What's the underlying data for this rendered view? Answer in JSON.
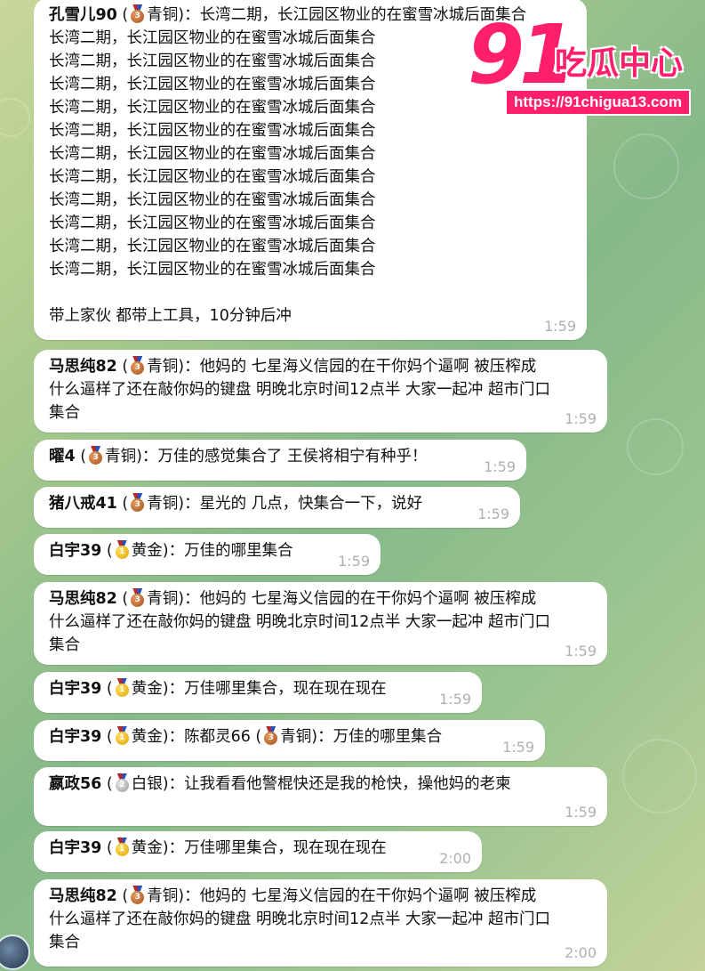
{
  "messages": [
    {
      "name": "孔雪儿90",
      "medal": "bronze",
      "rank": "青铜",
      "lines": [
        "长湾二期，长江园区物业的在蜜雪冰城后面集合",
        "长湾二期，长江园区物业的在蜜雪冰城后面集合",
        "长湾二期，长江园区物业的在蜜雪冰城后面集合",
        "长湾二期，长江园区物业的在蜜雪冰城后面集合",
        "长湾二期，长江园区物业的在蜜雪冰城后面集合",
        "长湾二期，长江园区物业的在蜜雪冰城后面集合",
        "长湾二期，长江园区物业的在蜜雪冰城后面集合",
        "长湾二期，长江园区物业的在蜜雪冰城后面集合",
        "长湾二期，长江园区物业的在蜜雪冰城后面集合",
        "长湾二期，长江园区物业的在蜜雪冰城后面集合",
        "长湾二期，长江园区物业的在蜜雪冰城后面集合",
        "长湾二期，长江园区物业的在蜜雪冰城后面集合",
        "",
        "带上家伙 都带上工具，10分钟后冲"
      ],
      "time": "1:59"
    },
    {
      "name": "马思纯82",
      "medal": "bronze",
      "rank": "青铜",
      "lines": [
        "他妈的 七星海义信园的在干你妈个逼啊 被压榨成",
        "什么逼样了还在敲你妈的键盘 明晚北京时间12点半 大家一起冲 超市门口",
        "集合"
      ],
      "time": "1:59"
    },
    {
      "name": "曜4",
      "medal": "bronze",
      "rank": "青铜",
      "lines": [
        "万佳的感觉集合了 王侯将相宁有种乎！"
      ],
      "time": "1:59"
    },
    {
      "name": "猪八戒41",
      "medal": "bronze",
      "rank": "青铜",
      "lines": [
        "星光的 几点，快集合一下，说好"
      ],
      "time": "1:59"
    },
    {
      "name": "白宇39",
      "medal": "gold",
      "rank": "黄金",
      "lines": [
        "万佳的哪里集合"
      ],
      "time": "1:59"
    },
    {
      "name": "马思纯82",
      "medal": "bronze",
      "rank": "青铜",
      "lines": [
        "他妈的 七星海义信园的在干你妈个逼啊 被压榨成",
        "什么逼样了还在敲你妈的键盘 明晚北京时间12点半 大家一起冲 超市门口",
        "集合"
      ],
      "time": "1:59"
    },
    {
      "name": "白宇39",
      "medal": "gold",
      "rank": "黄金",
      "lines": [
        "万佳哪里集合，现在现在现在"
      ],
      "time": "1:59"
    },
    {
      "name": "白宇39",
      "medal": "gold",
      "rank": "黄金",
      "lines": [
        "陈都灵66",
        "万佳的哪里集合"
      ],
      "inline_quote": {
        "name": "陈都灵66",
        "medal": "bronze",
        "rank": "青铜",
        "text": "万佳的哪里集合"
      },
      "time": "1:59"
    },
    {
      "name": "嬴政56",
      "medal": "silver",
      "rank": "白银",
      "lines": [
        "让我看看他警棍快还是我的枪快，操他妈的老柬"
      ],
      "time": "1:59"
    },
    {
      "name": "白宇39",
      "medal": "gold",
      "rank": "黄金",
      "lines": [
        "万佳哪里集合，现在现在现在"
      ],
      "time": "2:00"
    },
    {
      "name": "马思纯82",
      "medal": "bronze",
      "rank": "青铜",
      "lines": [
        "他妈的 七星海义信园的在干你妈个逼啊 被压榨成",
        "什么逼样了还在敲你妈的键盘 明晚北京时间12点半 大家一起冲 超市门口",
        "集合"
      ],
      "time": "2:00"
    }
  ],
  "watermark": {
    "brand_number": "91",
    "brand_text": "吃瓜中心",
    "url": "https://91chigua13.com"
  },
  "colors": {
    "bubble": "#ffffff",
    "time": "#b0b0b0",
    "watermark": "#ff1f6b"
  }
}
